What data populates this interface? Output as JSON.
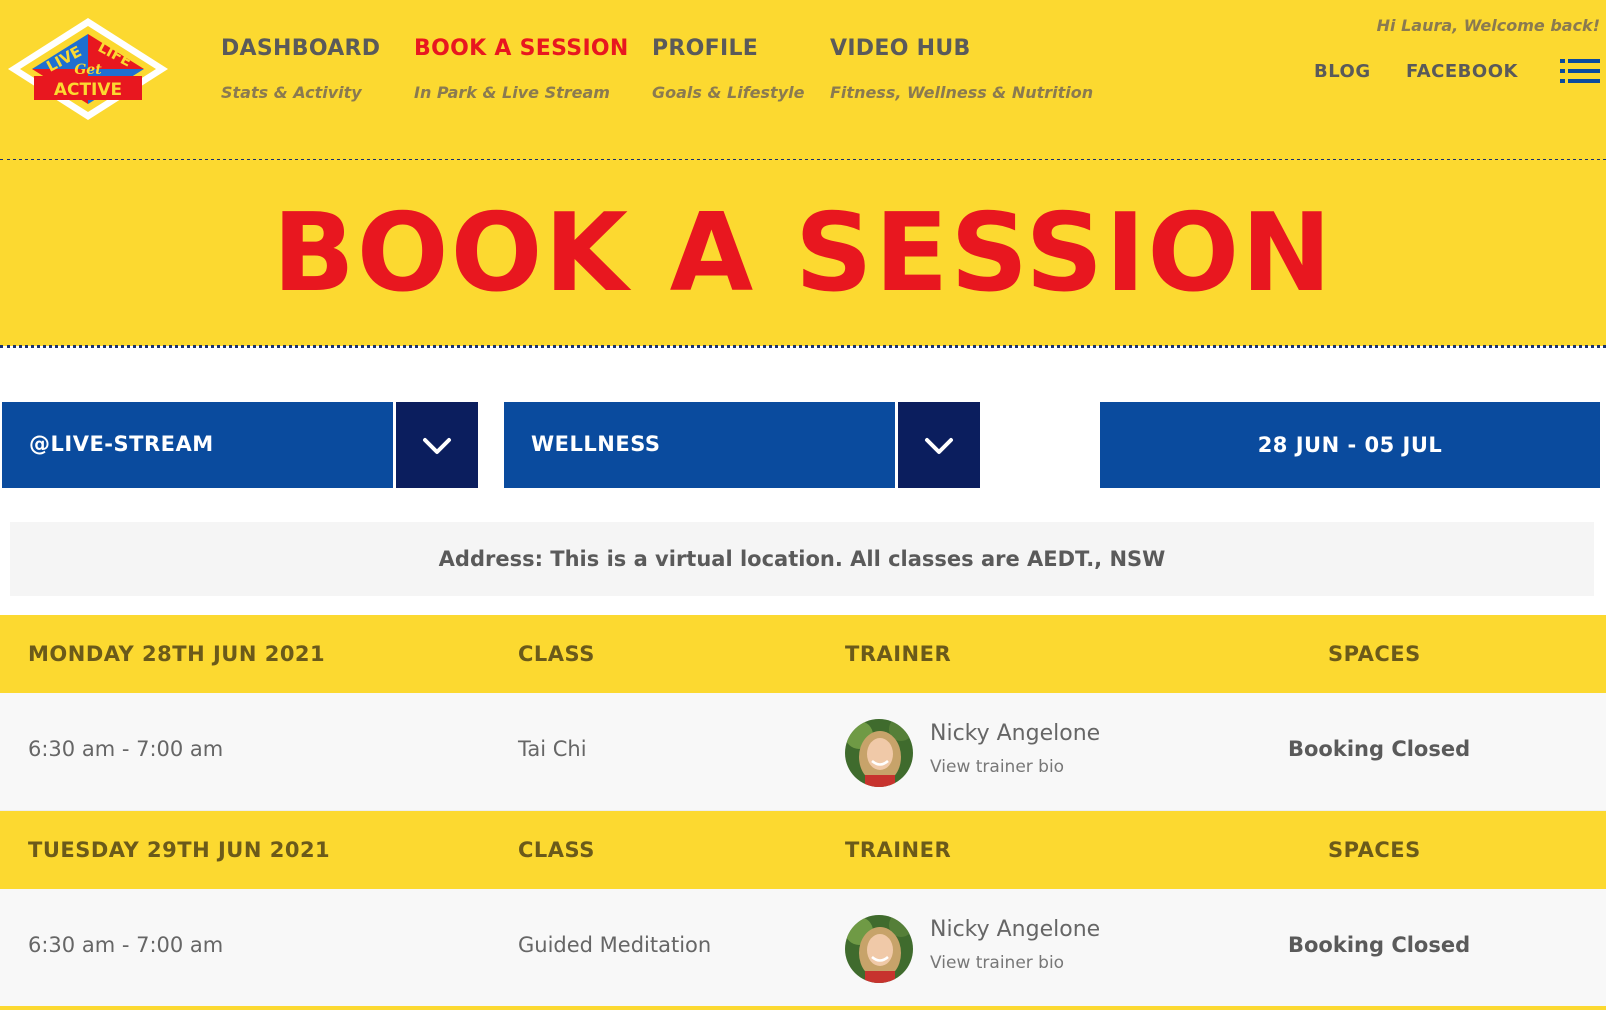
{
  "brand": {
    "logo_top_left": "LIVE",
    "logo_top_right": "LIFE",
    "logo_middle": "Get",
    "logo_bottom": "ACTIVE",
    "colors": {
      "yellow": "#fcd930",
      "red": "#e8171f",
      "blue": "#0a4b9e",
      "navy": "#0b1e5e"
    }
  },
  "nav": {
    "items": [
      {
        "title": "DASHBOARD",
        "subtitle": "Stats & Activity"
      },
      {
        "title": "BOOK A SESSION",
        "subtitle": "In Park & Live Stream"
      },
      {
        "title": "PROFILE",
        "subtitle": "Goals & Lifestyle"
      },
      {
        "title": "VIDEO HUB",
        "subtitle": "Fitness, Wellness & Nutrition"
      }
    ],
    "welcome": "Hi Laura, Welcome back!",
    "blog": "BLOG",
    "facebook": "FACEBOOK",
    "menu_icon": "hamburger-list-icon"
  },
  "hero": {
    "title": "BOOK A SESSION"
  },
  "filters": {
    "location": "@LIVE-STREAM",
    "category": "WELLNESS",
    "date_range": "28 JUN - 05 JUL",
    "chevron_icon": "chevron-down-icon"
  },
  "address": "Address: This is a virtual location. All classes are AEDT., NSW",
  "schedule": [
    {
      "day": "MONDAY 28TH JUN 2021",
      "col_class": "CLASS",
      "col_trainer": "TRAINER",
      "col_spaces": "SPACES",
      "session": {
        "time": "6:30 am - 7:00 am",
        "class": "Tai Chi",
        "trainer": "Nicky Angelone",
        "bio": "View trainer bio",
        "status": "Booking Closed"
      }
    },
    {
      "day": "TUESDAY 29TH JUN 2021",
      "col_class": "CLASS",
      "col_trainer": "TRAINER",
      "col_spaces": "SPACES",
      "session": {
        "time": "6:30 am - 7:00 am",
        "class": "Guided Meditation",
        "trainer": "Nicky Angelone",
        "bio": "View trainer bio",
        "status": "Booking Closed"
      }
    }
  ]
}
